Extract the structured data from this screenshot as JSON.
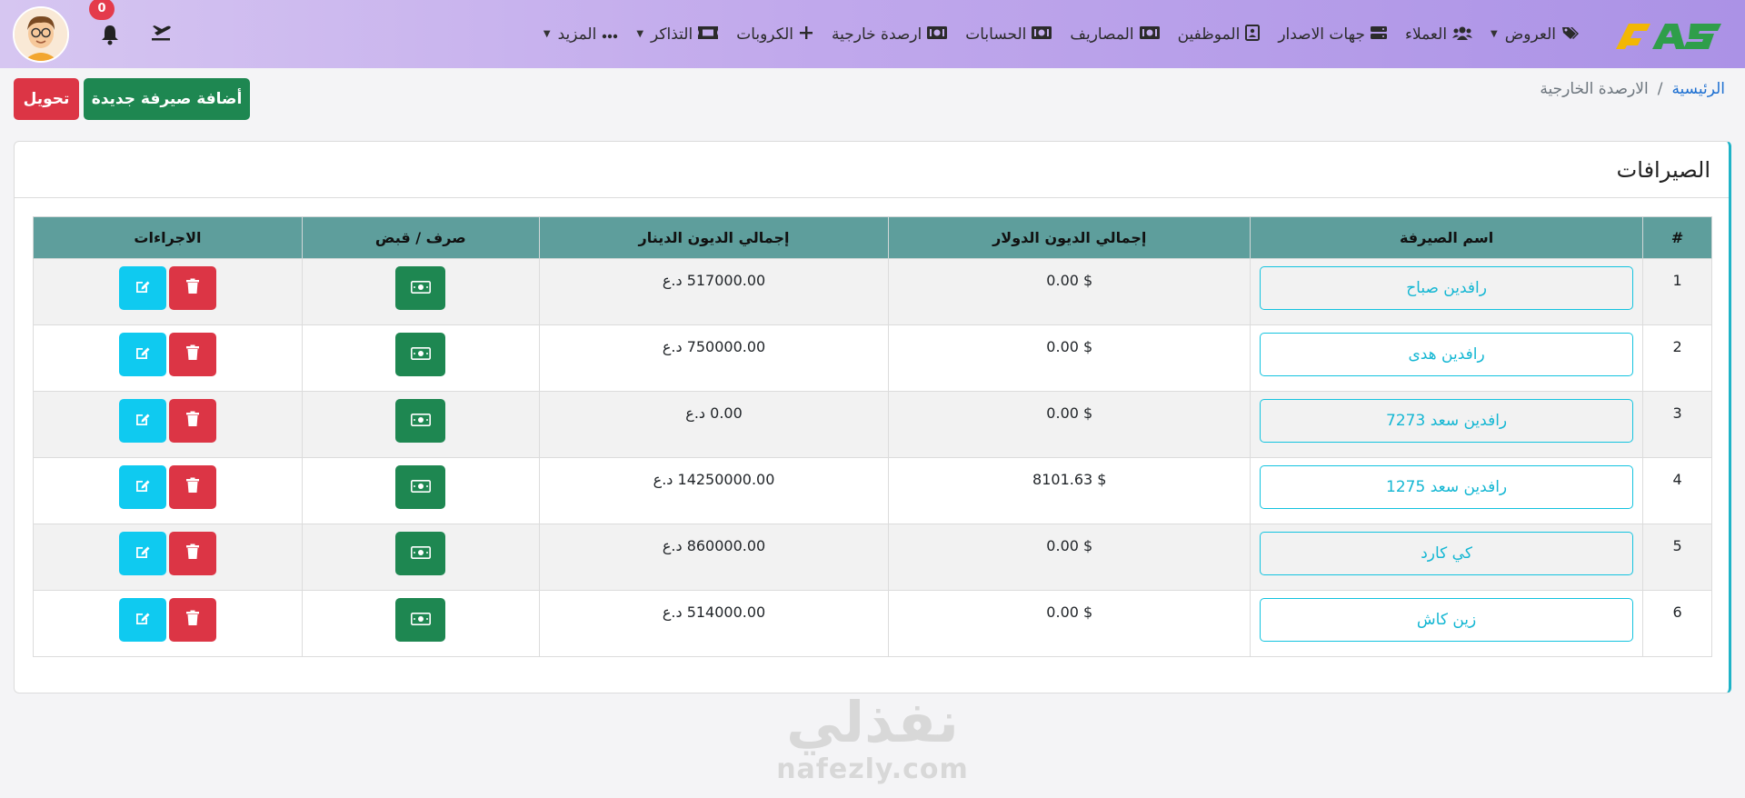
{
  "nav": {
    "items": [
      {
        "label": "العروض",
        "icon": "tags-icon",
        "has_caret": true
      },
      {
        "label": "العملاء",
        "icon": "users-icon",
        "has_caret": false
      },
      {
        "label": "جهات الاصدار",
        "icon": "server-icon",
        "has_caret": false
      },
      {
        "label": "الموظفين",
        "icon": "id-card-icon",
        "has_caret": false
      },
      {
        "label": "المصاريف",
        "icon": "money-icon",
        "has_caret": false
      },
      {
        "label": "الحسابات",
        "icon": "money-icon",
        "has_caret": false
      },
      {
        "label": "ارصدة خارجية",
        "icon": "money-icon",
        "has_caret": false
      },
      {
        "label": "الكروبات",
        "icon": "plus-icon",
        "has_caret": false
      },
      {
        "label": "التذاكر",
        "icon": "ticket-icon",
        "has_caret": true
      },
      {
        "label": "المزيد",
        "icon": "ellipsis-icon",
        "has_caret": true
      }
    ],
    "notification_count": "0"
  },
  "breadcrumb": {
    "home": "الرئيسية",
    "separator": "/",
    "current": "الارصدة الخارجية"
  },
  "actions": {
    "add_label": "أضافة صيرفة جديدة",
    "transfer_label": "تحويل"
  },
  "card": {
    "title": "الصيرافات"
  },
  "table": {
    "headers": {
      "num": "#",
      "name": "اسم الصيرفة",
      "usd": "إجمالي الديون الدولار",
      "iqd": "إجمالي الديون الدينار",
      "pay": "صرف / قبض",
      "actions": "الاجراءات"
    },
    "rows": [
      {
        "num": "1",
        "name": "رافدين صباح",
        "usd": "$ 0.00",
        "iqd": "517000.00 د.ع"
      },
      {
        "num": "2",
        "name": "رافدين هدى",
        "usd": "$ 0.00",
        "iqd": "750000.00 د.ع"
      },
      {
        "num": "3",
        "name": "رافدين سعد 7273",
        "usd": "$ 0.00",
        "iqd": "0.00 د.ع"
      },
      {
        "num": "4",
        "name": "رافدين سعد 1275",
        "usd": "$ 8101.63",
        "iqd": "14250000.00 د.ع"
      },
      {
        "num": "5",
        "name": "كي كارد",
        "usd": "$ 0.00",
        "iqd": "860000.00 د.ع"
      },
      {
        "num": "6",
        "name": "زين كاش",
        "usd": "$ 0.00",
        "iqd": "514000.00 د.ع"
      }
    ]
  },
  "watermark": {
    "arabic": "نفذلي",
    "latin": "nafezly.com"
  },
  "colors": {
    "primary_green": "#1e8751",
    "danger_red": "#dc3545",
    "info_cyan": "#0fcaf0",
    "table_header": "#5e9e9c",
    "link_blue": "#1d6fd1"
  }
}
